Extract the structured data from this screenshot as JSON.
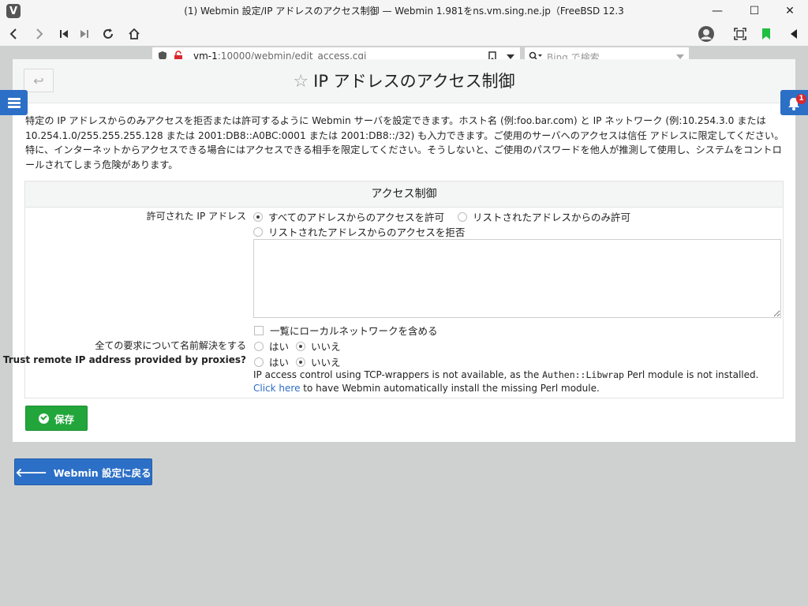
{
  "window": {
    "title": "(1) Webmin 設定/IP アドレスのアクセス制御 — Webmin 1.981をns.vm.sing.ne.jp（FreeBSD 12.3",
    "minimize": "—",
    "maximize": "☐",
    "close": "✕"
  },
  "browser": {
    "url_host": "vm-1",
    "url_path": ":10000/webmin/edit_access.cgi",
    "search_placeholder": "Bing で検索"
  },
  "page": {
    "title": "IP アドレスのアクセス制御",
    "description": "特定の IP アドレスからのみアクセスを拒否または許可するように Webmin サーバを設定できます。ホスト名 (例:foo.bar.com) と IP ネットワーク (例:10.254.3.0 または 10.254.1.0/255.255.255.128 または 2001:DB8::A0BC:0001 または 2001:DB8::/32) も入力できます。ご使用のサーバへのアクセスは信任 アドレスに限定してください。特に、インターネットからアクセスできる場合にはアクセスできる相手を限定してください。そうしないと、ご使用のパスワードを他人が推測して使用し、システムをコントロールされてしまう危険があります。",
    "notification_count": "1"
  },
  "form": {
    "header": "アクセス制御",
    "allowed_ip_label": "許可された IP アドレス",
    "opt_allow_all": "すべてのアドレスからのアクセスを許可",
    "opt_allow_listed": "リストされたアドレスからのみ許可",
    "opt_deny_listed": "リストされたアドレスからのアクセスを拒否",
    "include_local_label": "一覧にローカルネットワークを含める",
    "resolve_label": "全ての要求について名前解決をする",
    "proxy_label": "Trust remote IP address provided by proxies?",
    "yes": "はい",
    "no": "いいえ",
    "note_part1": "IP access control using TCP-wrappers is not available, as the ",
    "note_code": "Authen::Libwrap",
    "note_part2": " Perl module is not installed. ",
    "note_link": "Click here",
    "note_part3": " to have Webmin automatically install the missing Perl module."
  },
  "buttons": {
    "save": "保存",
    "back": "Webmin 設定に戻る"
  }
}
